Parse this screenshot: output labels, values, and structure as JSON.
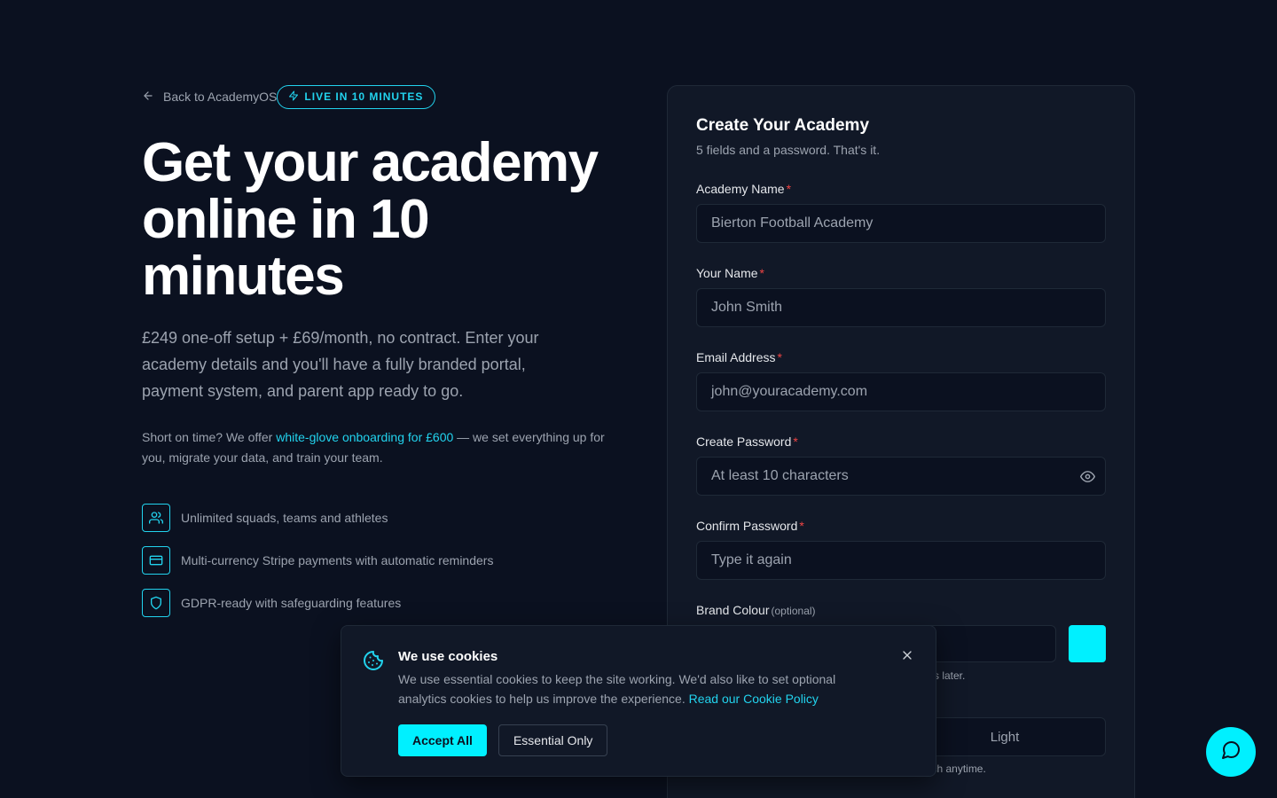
{
  "header": {
    "back_label": "Back to AcademyOS",
    "badge_label": "LIVE IN 10 MINUTES"
  },
  "hero": {
    "title": "Get your academy online in 10 minutes",
    "subtitle": "£249 one-off setup + £69/month, no contract. Enter your academy details and you'll have a fully branded portal, payment system, and parent app ready to go.",
    "note_prefix": "Short on time? We offer ",
    "note_link": "white-glove onboarding for £600",
    "note_suffix": " — we set everything up for you, migrate your data, and train your team."
  },
  "features": [
    {
      "icon": "users-icon",
      "label": "Unlimited squads, teams and athletes"
    },
    {
      "icon": "credit-card-icon",
      "label": "Multi-currency Stripe payments with automatic reminders"
    },
    {
      "icon": "shield-icon",
      "label": "GDPR-ready with safeguarding features"
    }
  ],
  "form": {
    "title": "Create Your Academy",
    "subtitle": "5 fields and a password. That's it.",
    "academy_name": {
      "label": "Academy Name",
      "placeholder": "Bierton Football Academy"
    },
    "your_name": {
      "label": "Your Name",
      "placeholder": "John Smith"
    },
    "email": {
      "label": "Email Address",
      "placeholder": "john@youracademy.com"
    },
    "password": {
      "label": "Create Password",
      "placeholder": "At least 10 characters"
    },
    "confirm": {
      "label": "Confirm Password",
      "placeholder": "Type it again"
    },
    "brand": {
      "label": "Brand Colour",
      "optional": "(optional)",
      "hint_visible": "s later.",
      "swatch_color": "#00f0ff"
    },
    "theme": {
      "light_label": "Light",
      "hint_visible": "How your portal looks by default. Parents can switch anytime."
    }
  },
  "cookie": {
    "title": "We use cookies",
    "text": "We use essential cookies to keep the site working. We'd also like to set optional analytics cookies to help us improve the experience. ",
    "link": "Read our Cookie Policy",
    "accept_label": "Accept All",
    "essential_label": "Essential Only"
  },
  "colors": {
    "accent": "#00f0ff",
    "background": "#0b1120",
    "card": "#111827",
    "required": "#ef4444"
  }
}
